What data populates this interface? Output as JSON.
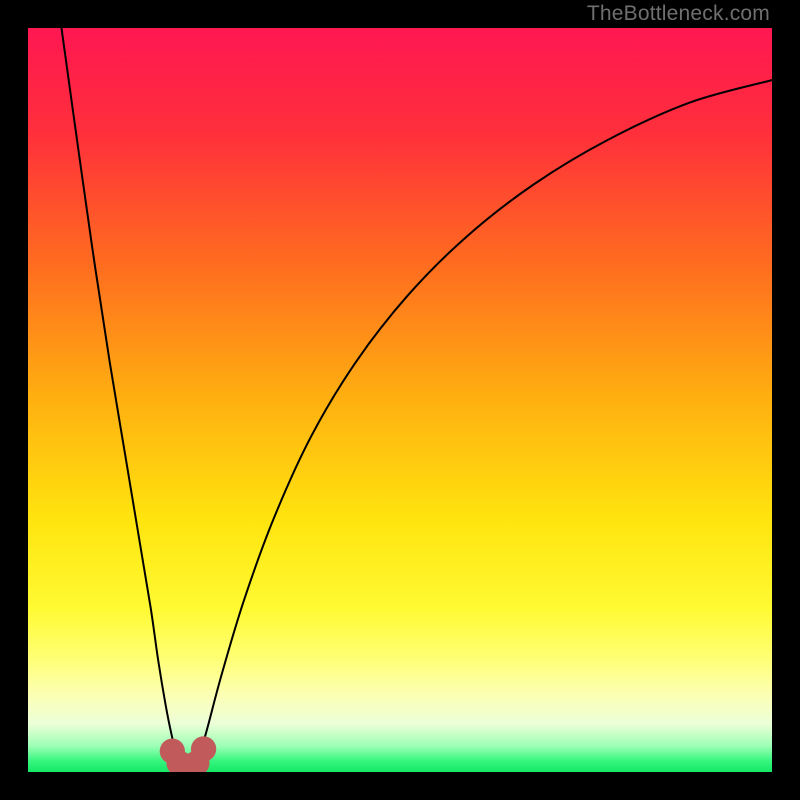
{
  "watermark": "TheBottleneck.com",
  "chart_data": {
    "type": "line",
    "title": "",
    "xlabel": "",
    "ylabel": "",
    "xlim": [
      0,
      100
    ],
    "ylim": [
      0,
      100
    ],
    "gradient_stops": [
      {
        "pos": 0,
        "color": "#ff1752"
      },
      {
        "pos": 0.14,
        "color": "#ff2f3b"
      },
      {
        "pos": 0.32,
        "color": "#ff6d1f"
      },
      {
        "pos": 0.5,
        "color": "#ffb010"
      },
      {
        "pos": 0.66,
        "color": "#ffe40e"
      },
      {
        "pos": 0.78,
        "color": "#fffa32"
      },
      {
        "pos": 0.845,
        "color": "#ffff72"
      },
      {
        "pos": 0.9,
        "color": "#fbffb8"
      },
      {
        "pos": 0.935,
        "color": "#ecffd7"
      },
      {
        "pos": 0.965,
        "color": "#9dffb5"
      },
      {
        "pos": 0.985,
        "color": "#37f67f"
      },
      {
        "pos": 1.0,
        "color": "#15e765"
      }
    ],
    "series": [
      {
        "name": "left-curve",
        "stroke": "#000000",
        "points": [
          {
            "x": 4.5,
            "y": 100
          },
          {
            "x": 7.0,
            "y": 82
          },
          {
            "x": 9.0,
            "y": 68
          },
          {
            "x": 11.0,
            "y": 55
          },
          {
            "x": 13.0,
            "y": 43
          },
          {
            "x": 15.0,
            "y": 31
          },
          {
            "x": 16.5,
            "y": 22
          },
          {
            "x": 17.5,
            "y": 15
          },
          {
            "x": 18.5,
            "y": 9
          },
          {
            "x": 19.3,
            "y": 5
          },
          {
            "x": 20.0,
            "y": 2.3
          },
          {
            "x": 20.6,
            "y": 1.3
          }
        ]
      },
      {
        "name": "right-curve",
        "stroke": "#000000",
        "points": [
          {
            "x": 22.4,
            "y": 1.3
          },
          {
            "x": 23.0,
            "y": 2.3
          },
          {
            "x": 24.0,
            "y": 5.5
          },
          {
            "x": 26.0,
            "y": 13
          },
          {
            "x": 29.0,
            "y": 23
          },
          {
            "x": 33.0,
            "y": 34
          },
          {
            "x": 38.0,
            "y": 45
          },
          {
            "x": 44.0,
            "y": 55
          },
          {
            "x": 51.0,
            "y": 64
          },
          {
            "x": 59.0,
            "y": 72
          },
          {
            "x": 68.0,
            "y": 79
          },
          {
            "x": 78.0,
            "y": 85
          },
          {
            "x": 89.0,
            "y": 90
          },
          {
            "x": 100,
            "y": 93
          }
        ]
      }
    ],
    "markers": [
      {
        "x": 19.4,
        "y": 2.8,
        "r": 1.7,
        "color": "#c15b5b"
      },
      {
        "x": 20.3,
        "y": 1.2,
        "r": 1.7,
        "color": "#c15b5b"
      },
      {
        "x": 21.5,
        "y": 0.8,
        "r": 1.7,
        "color": "#c15b5b"
      },
      {
        "x": 22.7,
        "y": 1.2,
        "r": 1.7,
        "color": "#c15b5b"
      },
      {
        "x": 23.6,
        "y": 3.1,
        "r": 1.7,
        "color": "#c15b5b"
      }
    ]
  }
}
